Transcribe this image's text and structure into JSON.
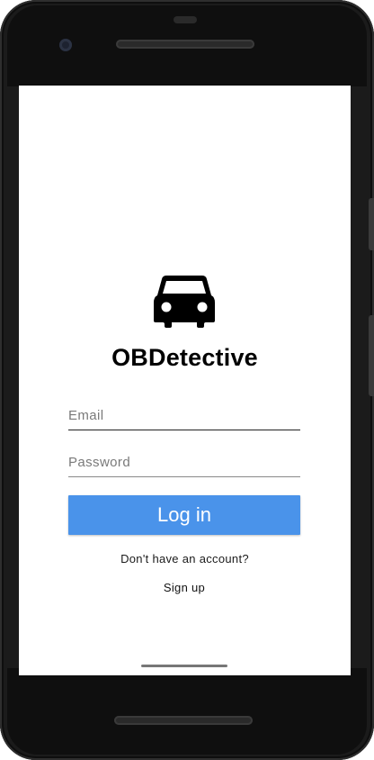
{
  "app": {
    "title": "OBDetective",
    "logo_icon": "car-icon"
  },
  "form": {
    "email_placeholder": "Email",
    "email_value": "",
    "password_placeholder": "Password",
    "password_value": "",
    "login_label": "Log in",
    "login_color": "#4a93ea"
  },
  "footer": {
    "no_account_text": "Don't have an account?",
    "signup_label": "Sign up"
  }
}
